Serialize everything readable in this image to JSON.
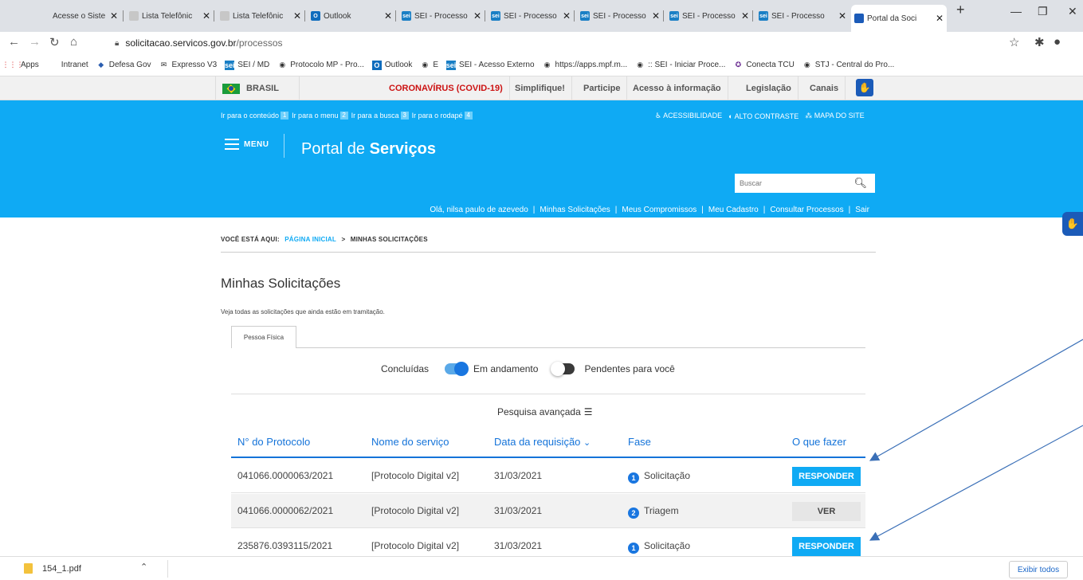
{
  "browser": {
    "tabs": [
      {
        "label": "Acesse o Siste",
        "icon": "none"
      },
      {
        "label": "Lista Telefônic",
        "icon": "doc"
      },
      {
        "label": "Lista Telefônic",
        "icon": "doc"
      },
      {
        "label": "Outlook",
        "icon": "outlook"
      },
      {
        "label": "SEI - Processo",
        "icon": "sei"
      },
      {
        "label": "SEI - Processo",
        "icon": "sei"
      },
      {
        "label": "SEI - Processo",
        "icon": "sei"
      },
      {
        "label": "SEI - Processo",
        "icon": "sei"
      },
      {
        "label": "SEI - Processo",
        "icon": "sei"
      },
      {
        "label": "Portal da Soci",
        "icon": "portal",
        "active": true
      }
    ],
    "url_host": "solicitacao.servicos.gov.br",
    "url_path": "/processos",
    "bookmarks": [
      {
        "label": "Apps",
        "icon": "apps-grid"
      },
      {
        "label": "Intranet",
        "icon": "none"
      },
      {
        "label": "Defesa Gov",
        "icon": "defesa"
      },
      {
        "label": "Expresso V3",
        "icon": "expresso"
      },
      {
        "label": "SEI / MD",
        "icon": "sei"
      },
      {
        "label": "Protocolo MP - Pro...",
        "icon": "globe"
      },
      {
        "label": "Outlook",
        "icon": "outlook"
      },
      {
        "label": "E",
        "icon": "globe"
      },
      {
        "label": "SEI - Acesso Externo",
        "icon": "sei"
      },
      {
        "label": "https://apps.mpf.m...",
        "icon": "globe"
      },
      {
        "label": ":: SEI - Iniciar Proce...",
        "icon": "globe"
      },
      {
        "label": "Conecta TCU",
        "icon": "tcu"
      },
      {
        "label": "STJ - Central do Pro...",
        "icon": "globe"
      }
    ]
  },
  "govbar": {
    "brasil": "BRASIL",
    "items": [
      "CORONAVÍRUS (COVID-19)",
      "Simplifique!",
      "Participe",
      "Acesso à informação",
      "Legislação",
      "Canais"
    ]
  },
  "header": {
    "skip_links": [
      "Ir para o conteúdo",
      "Ir para o menu",
      "Ir para a busca",
      "Ir para o rodapé"
    ],
    "skip_keys": [
      "1",
      "2",
      "3",
      "4"
    ],
    "access_links": [
      "ACESSIBILIDADE",
      "ALTO CONTRASTE",
      "MAPA DO SITE"
    ],
    "menu_label": "MENU",
    "portal_title_prefix": "Portal de ",
    "portal_title_bold": "Serviços",
    "search_placeholder": "Buscar",
    "user_nav": [
      "Olá, nilsa paulo de azevedo",
      "Minhas Solicitações",
      "Meus Compromissos",
      "Meu Cadastro",
      "Consultar Processos",
      "Sair"
    ]
  },
  "breadcrumb": {
    "prefix": "VOCÊ ESTÁ AQUI:",
    "home": "PÁGINA INICIAL",
    "separator": ">",
    "current": "MINHAS SOLICITAÇÕES"
  },
  "main": {
    "title": "Minhas Solicitações",
    "subtitle": "Veja todas as solicitações que ainda estão em tramitação.",
    "tab": "Pessoa Física",
    "filters": {
      "concluidas": "Concluídas",
      "em_andamento": "Em andamento",
      "pendentes": "Pendentes para você"
    },
    "advanced_search": "Pesquisa avançada",
    "table": {
      "headers": [
        "N° do Protocolo",
        "Nome do serviço",
        "Data da requisição",
        "Fase",
        "O que fazer"
      ],
      "rows": [
        {
          "protocolo": "041066.0000063/2021",
          "servico": "[Protocolo Digital v2]",
          "data": "31/03/2021",
          "fase_num": "1",
          "fase": "Solicitação",
          "acao": "RESPONDER"
        },
        {
          "protocolo": "041066.0000062/2021",
          "servico": "[Protocolo Digital v2]",
          "data": "31/03/2021",
          "fase_num": "2",
          "fase": "Triagem",
          "acao": "VER"
        },
        {
          "protocolo": "235876.0393115/2021",
          "servico": "[Protocolo Digital v2]",
          "data": "31/03/2021",
          "fase_num": "1",
          "fase": "Solicitação",
          "acao": "RESPONDER"
        }
      ]
    }
  },
  "downloads": {
    "file": "154_1.pdf",
    "show_all": "Exibir todos"
  },
  "colors": {
    "header_blue": "#0faaf4",
    "table_blue": "#1473d9",
    "annotation_arrow": "#3a6fb7"
  }
}
